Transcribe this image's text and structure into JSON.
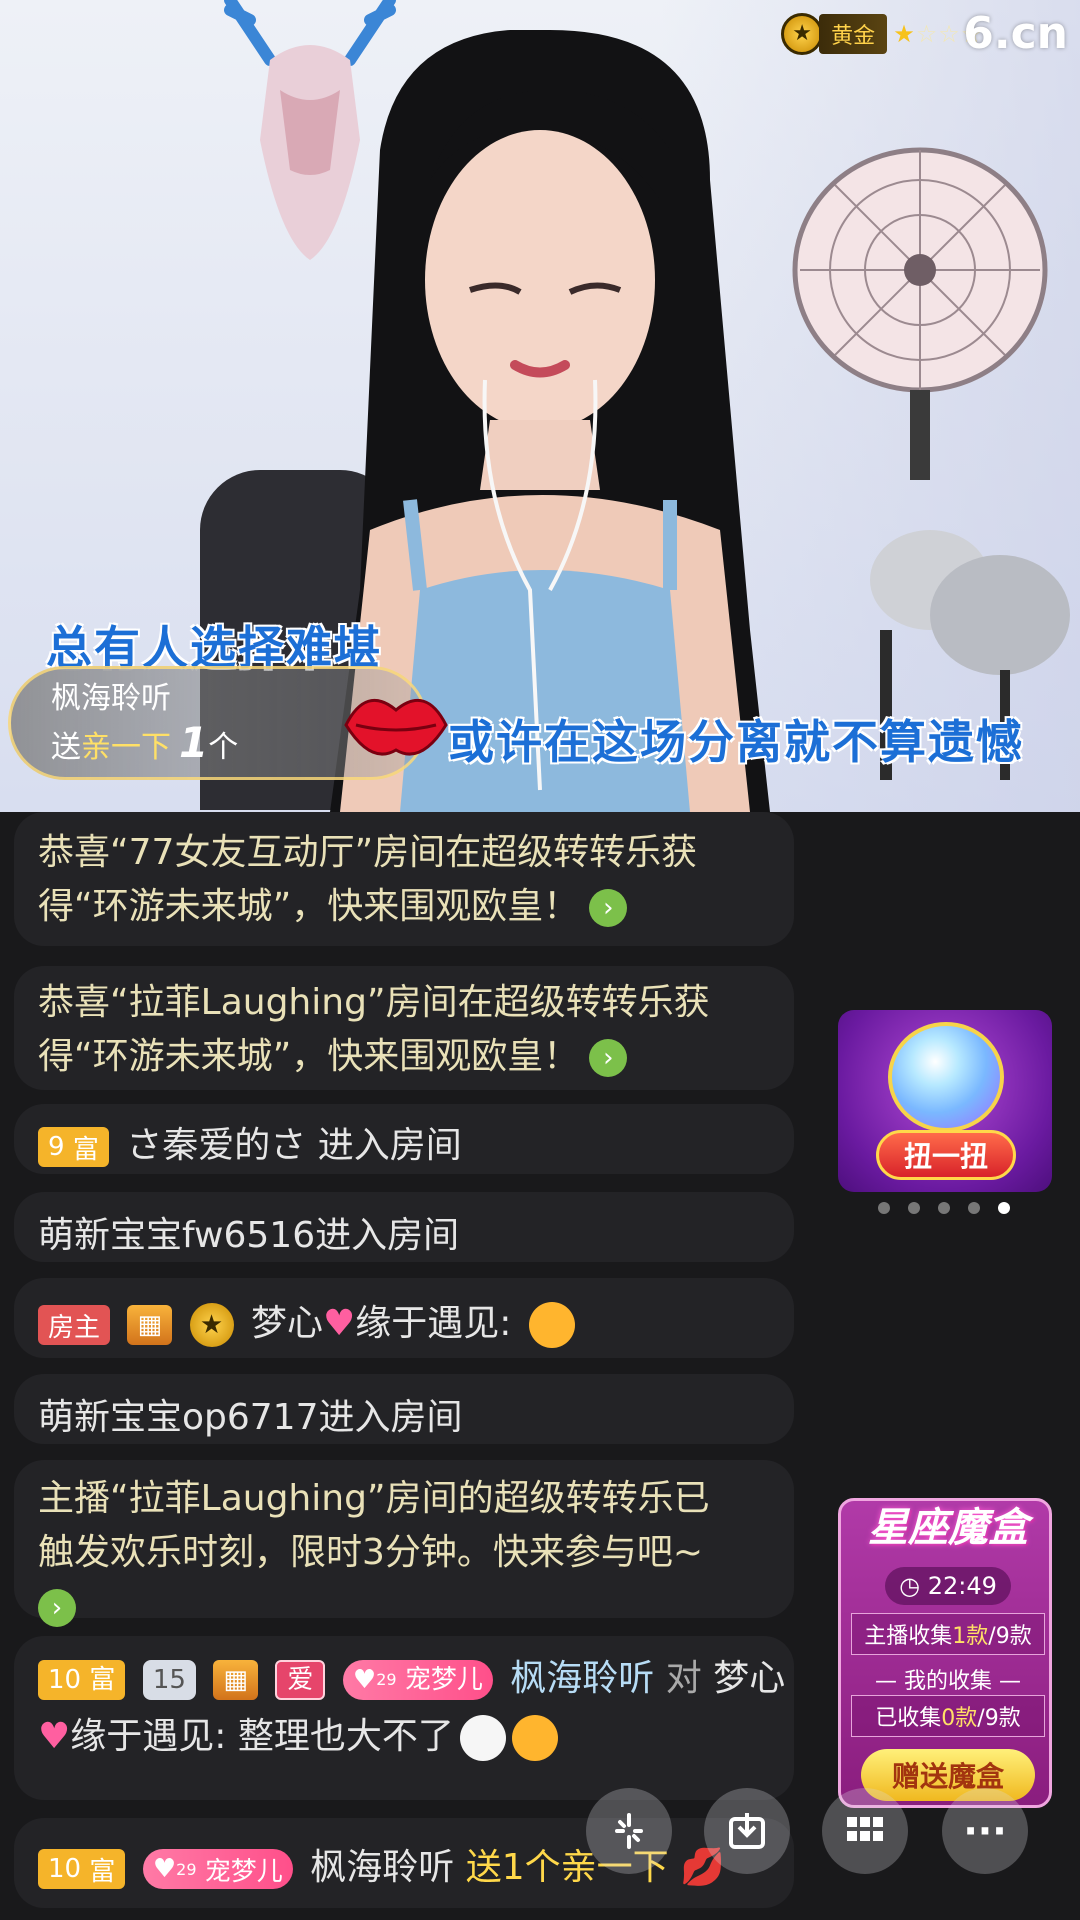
{
  "header": {
    "tier_label": "黄金",
    "stars_filled": 1,
    "stars_total": 4,
    "site_logo": "6.cn"
  },
  "video": {
    "lyric_line_1": "总有人选择难堪",
    "lyric_line_2": "或许在这场分离就不算遗憾"
  },
  "gift_banner": {
    "sender": "枫海聆听",
    "action": "送",
    "gift": "亲一下",
    "count": "1",
    "unit": "个"
  },
  "chat": {
    "m1_line1": "恭喜“77女友互动厅”房间在超级转转乐获",
    "m1_line2": "得“环游未来城”，快来围观欧皇！",
    "m2_line1": "恭喜“拉菲Laughing”房间在超级转转乐获",
    "m2_line2": "得“环游未来城”，快来围观欧皇！",
    "m3_rich_level": "9",
    "m3_rich_label": "富",
    "m3_user": "さ秦爱的さ",
    "m3_action": "进入房间",
    "m4_text": "萌新宝宝fw6516进入房间",
    "m5_owner_label": "房主",
    "m5_user": "梦心",
    "m5_user_suffix": "缘于遇见:",
    "m6_text": "萌新宝宝op6717进入房间",
    "m7_line1": "主播“拉菲Laughing”房间的超级转转乐已",
    "m7_line2": "触发欢乐时刻，限时3分钟。快来参与吧~",
    "m8_rich_level": "10",
    "m8_rich_label": "富",
    "m8_shield_level": "15",
    "m8_love_label": "爱",
    "m8_pet_level": "29",
    "m8_pet_label": "宠梦儿",
    "m8_sender": "枫海聆听",
    "m8_to": "对",
    "m8_target": "梦心",
    "m8_line2": "缘于遇见: 整理也大不了",
    "m9_rich_level": "10",
    "m9_rich_label": "富",
    "m9_pet_level": "29",
    "m9_pet_label": "宠梦儿",
    "m9_sender": "枫海聆听",
    "m9_action": "送1个亲一下"
  },
  "gashapon": {
    "button_label": "扭一扭",
    "pages": 5,
    "active_page": 5
  },
  "magic_box": {
    "title": "星座魔盒",
    "timer": "22:49",
    "anchor_label": "主播收集",
    "anchor_count": "1款",
    "anchor_total": "/9款",
    "my_header": "— 我的收集 —",
    "my_label": "已收集",
    "my_count": "0款",
    "my_total": "/9款",
    "send_button": "赠送魔盒"
  },
  "actions": {
    "icons": [
      "sparkle-icon",
      "download-icon",
      "grid-icon",
      "more-icon"
    ],
    "more_label": "···"
  }
}
